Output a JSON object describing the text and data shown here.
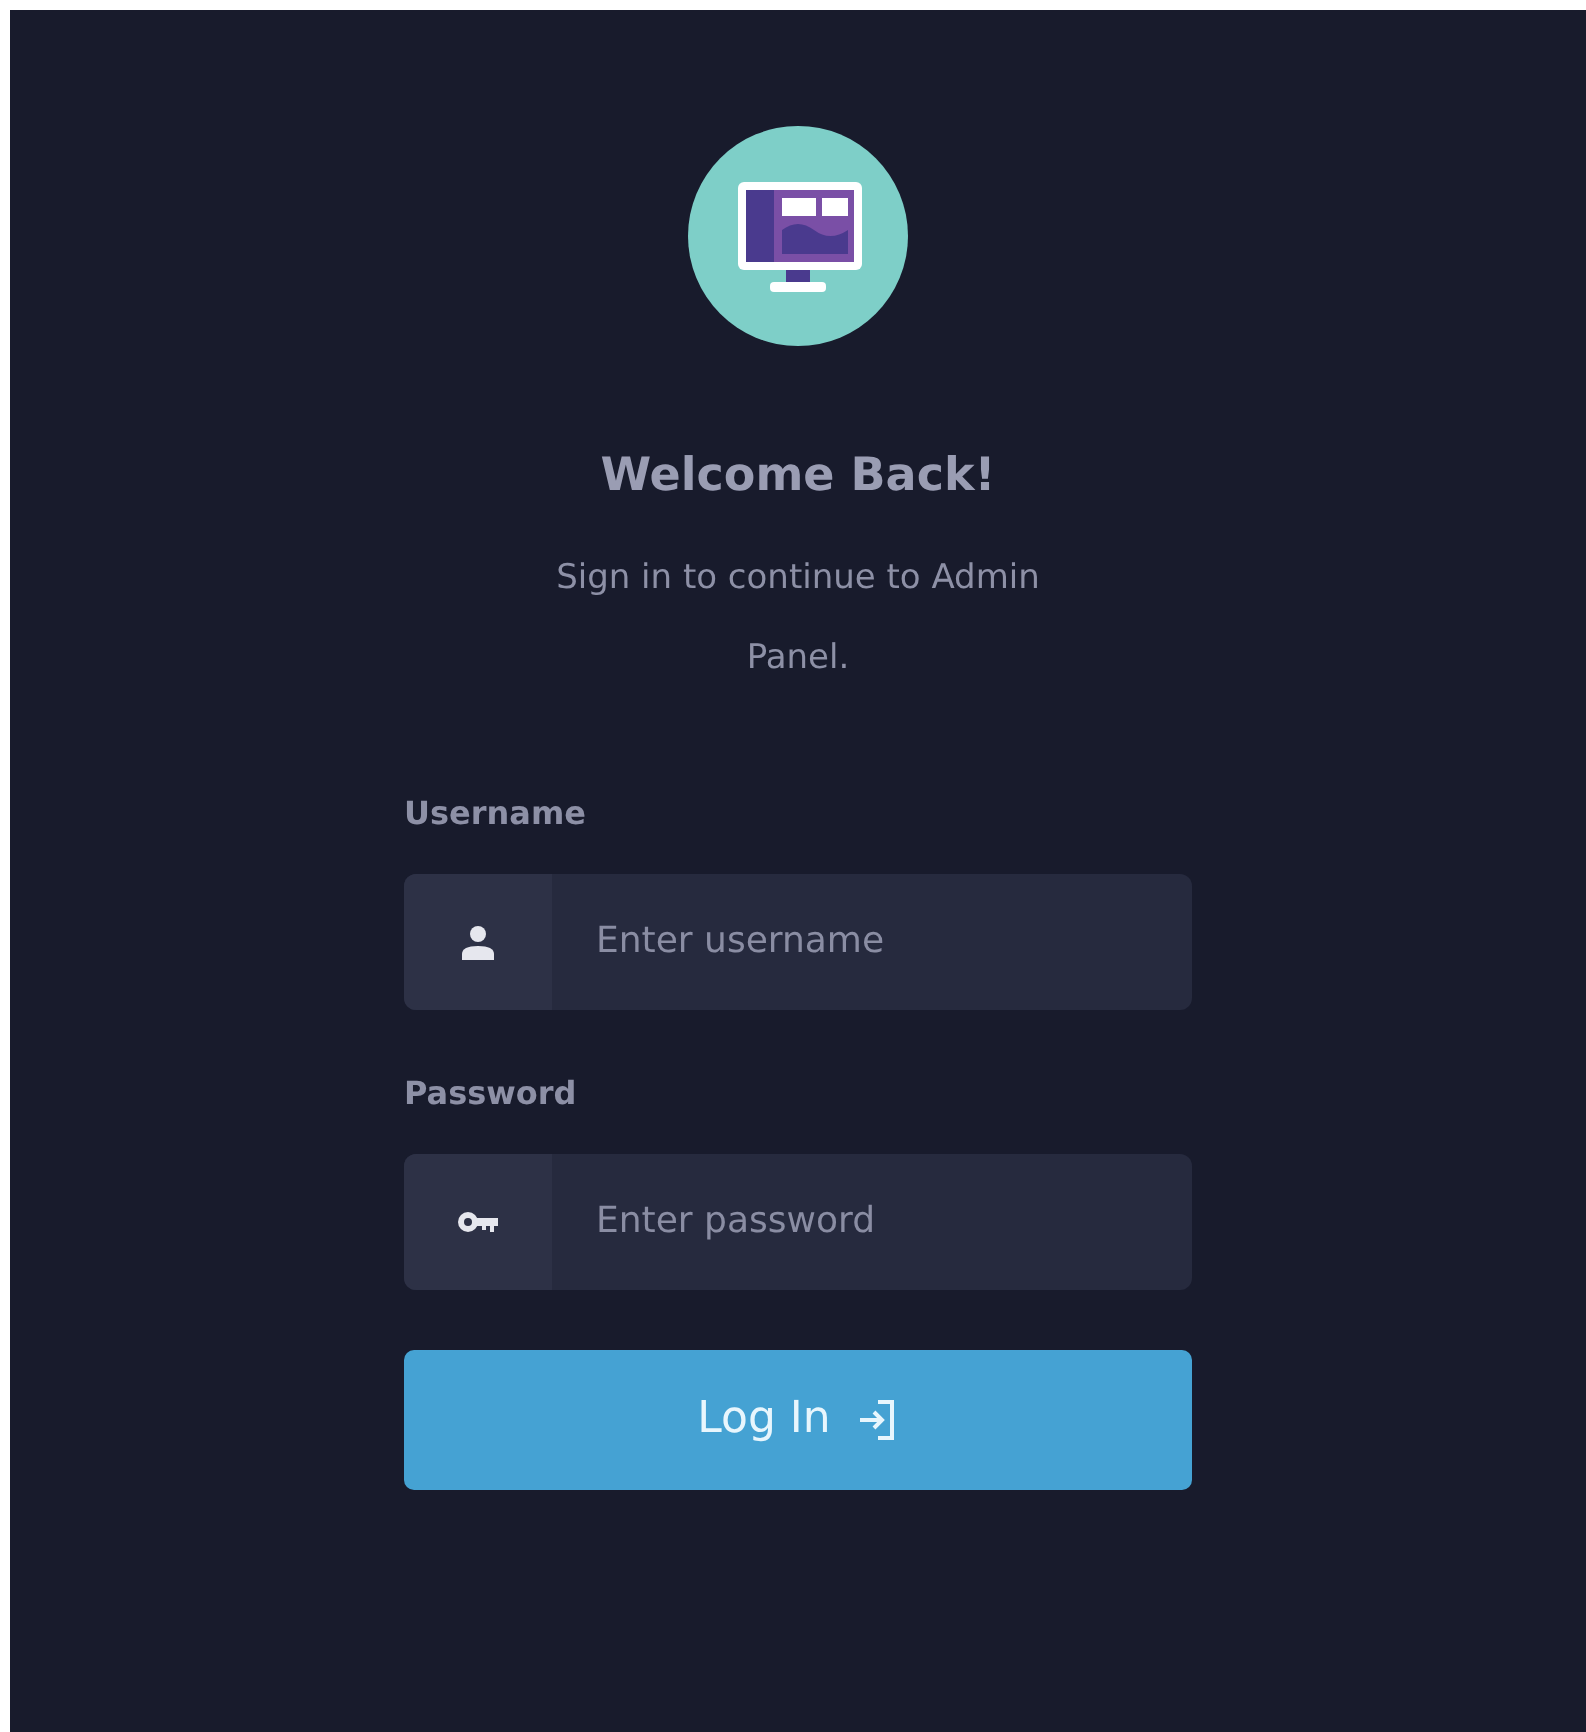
{
  "title": "Welcome Back!",
  "subtitle": "Sign in to continue to Admin Panel.",
  "fields": [
    {
      "label": "Username",
      "kind": "user",
      "placeholder": "Enter username"
    },
    {
      "label": "Password",
      "kind": "password",
      "placeholder": "Enter password"
    }
  ],
  "submit": {
    "label": "Log In"
  }
}
